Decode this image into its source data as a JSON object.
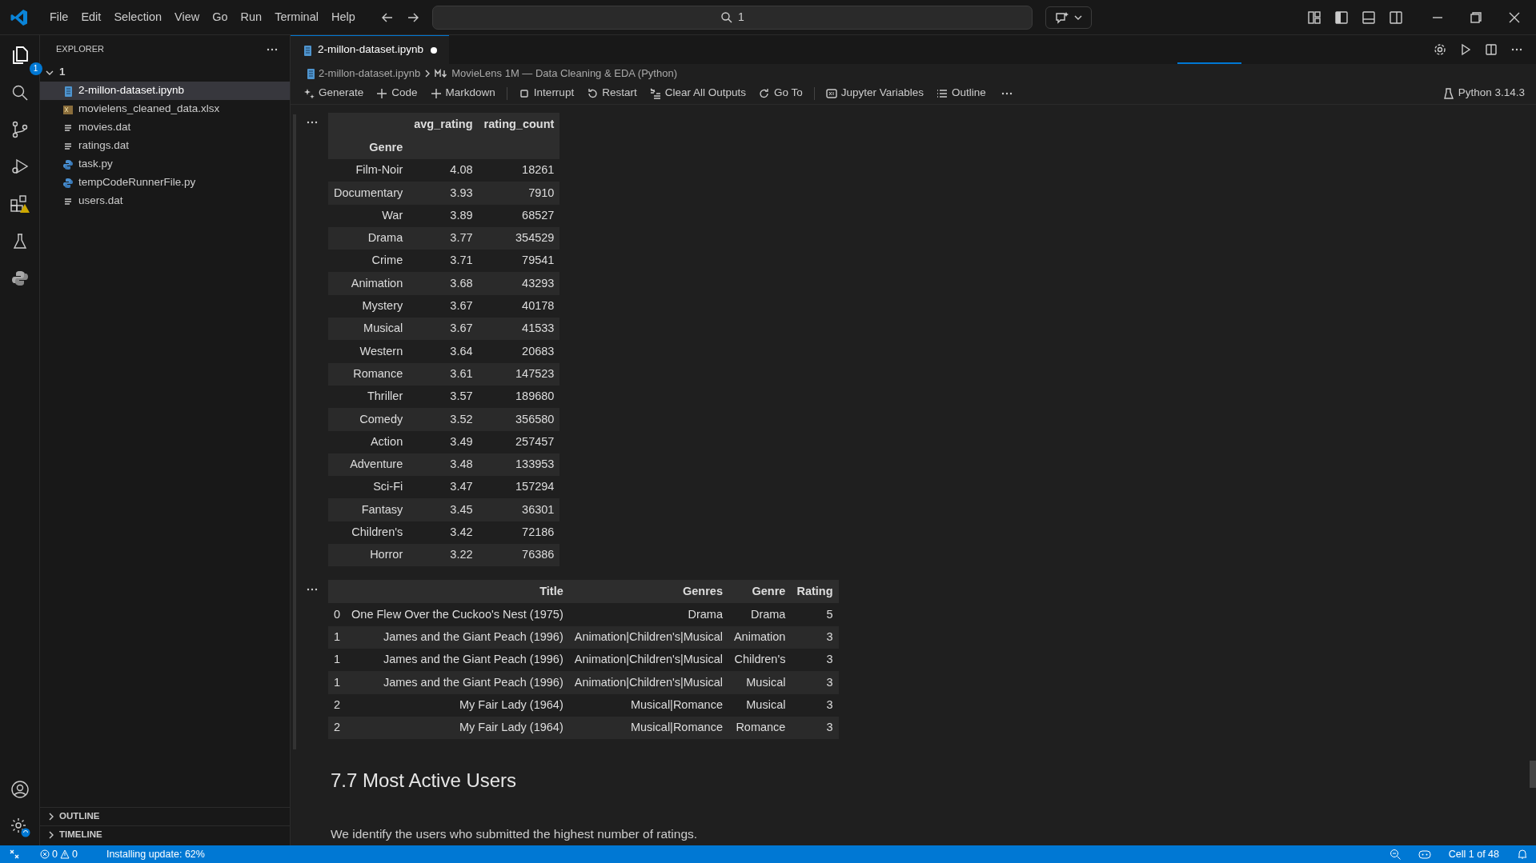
{
  "menu": [
    "File",
    "Edit",
    "Selection",
    "View",
    "Go",
    "Run",
    "Terminal",
    "Help"
  ],
  "command_center": {
    "text": "1"
  },
  "activity_badge": "1",
  "explorer": {
    "title": "EXPLORER",
    "folder": {
      "label": "1",
      "expanded": true
    },
    "files": [
      {
        "name": "2-millon-dataset.ipynb",
        "kind": "notebook",
        "selected": true
      },
      {
        "name": "movielens_cleaned_data.xlsx",
        "kind": "excel",
        "selected": false
      },
      {
        "name": "movies.dat",
        "kind": "text",
        "selected": false
      },
      {
        "name": "ratings.dat",
        "kind": "text",
        "selected": false
      },
      {
        "name": "task.py",
        "kind": "python",
        "selected": false
      },
      {
        "name": "tempCodeRunnerFile.py",
        "kind": "python",
        "selected": false
      },
      {
        "name": "users.dat",
        "kind": "text",
        "selected": false
      }
    ],
    "sections": [
      {
        "label": "OUTLINE",
        "expanded": false
      },
      {
        "label": "TIMELINE",
        "expanded": false
      }
    ]
  },
  "tabs": [
    {
      "label": "2-millon-dataset.ipynb",
      "modified": true,
      "selected": true
    }
  ],
  "breadcrumb": [
    "2-millon-dataset.ipynb",
    "MovieLens 1M — Data Cleaning & EDA (Python)"
  ],
  "toolbar": [
    {
      "label": "Generate",
      "kind": "sparkle"
    },
    {
      "label": "Code",
      "kind": "plus"
    },
    {
      "label": "Markdown",
      "kind": "plus"
    },
    {
      "label": "Interrupt",
      "kind": "stop"
    },
    {
      "label": "Restart",
      "kind": "restart"
    },
    {
      "label": "Clear All Outputs",
      "kind": "clear"
    },
    {
      "label": "Go To",
      "kind": "goto"
    },
    {
      "label": "Jupyter Variables",
      "kind": "variables"
    },
    {
      "label": "Outline",
      "kind": "list"
    }
  ],
  "kernel": "Python 3.14.3",
  "table_1": {
    "columns": [
      "",
      "avg_rating",
      "rating_count"
    ],
    "index_name": "Genre",
    "rows": [
      [
        "Film-Noir",
        "4.08",
        "18261"
      ],
      [
        "Documentary",
        "3.93",
        "7910"
      ],
      [
        "War",
        "3.89",
        "68527"
      ],
      [
        "Drama",
        "3.77",
        "354529"
      ],
      [
        "Crime",
        "3.71",
        "79541"
      ],
      [
        "Animation",
        "3.68",
        "43293"
      ],
      [
        "Mystery",
        "3.67",
        "40178"
      ],
      [
        "Musical",
        "3.67",
        "41533"
      ],
      [
        "Western",
        "3.64",
        "20683"
      ],
      [
        "Romance",
        "3.61",
        "147523"
      ],
      [
        "Thriller",
        "3.57",
        "189680"
      ],
      [
        "Comedy",
        "3.52",
        "356580"
      ],
      [
        "Action",
        "3.49",
        "257457"
      ],
      [
        "Adventure",
        "3.48",
        "133953"
      ],
      [
        "Sci-Fi",
        "3.47",
        "157294"
      ],
      [
        "Fantasy",
        "3.45",
        "36301"
      ],
      [
        "Children's",
        "3.42",
        "72186"
      ],
      [
        "Horror",
        "3.22",
        "76386"
      ]
    ]
  },
  "table_2": {
    "columns": [
      "",
      "Title",
      "Genres",
      "Genre",
      "Rating"
    ],
    "rows": [
      [
        "0",
        "One Flew Over the Cuckoo's Nest (1975)",
        "Drama",
        "Drama",
        "5"
      ],
      [
        "1",
        "James and the Giant Peach (1996)",
        "Animation|Children's|Musical",
        "Animation",
        "3"
      ],
      [
        "1",
        "James and the Giant Peach (1996)",
        "Animation|Children's|Musical",
        "Children's",
        "3"
      ],
      [
        "1",
        "James and the Giant Peach (1996)",
        "Animation|Children's|Musical",
        "Musical",
        "3"
      ],
      [
        "2",
        "My Fair Lady (1964)",
        "Musical|Romance",
        "Musical",
        "3"
      ],
      [
        "2",
        "My Fair Lady (1964)",
        "Musical|Romance",
        "Romance",
        "3"
      ]
    ]
  },
  "markdown": {
    "heading": "7.7 Most Active Users",
    "paragraph": "We identify the users who submitted the highest number of ratings."
  },
  "status_bar": {
    "errors": "0",
    "warnings": "0",
    "message": "Installing update: 62%",
    "cell": "Cell 1 of 48"
  }
}
